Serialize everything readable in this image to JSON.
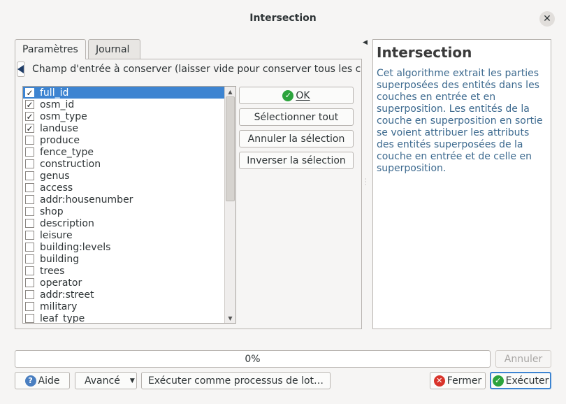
{
  "window": {
    "title": "Intersection"
  },
  "tabs": [
    {
      "label": "Paramètres",
      "active": true
    },
    {
      "label": "Journal",
      "active": false
    }
  ],
  "parameters": {
    "field_label": "Champ d'entrée à conserver (laisser vide pour conserver tous les champs)",
    "fields": [
      {
        "name": "full_id",
        "checked": true,
        "selected": true
      },
      {
        "name": "osm_id",
        "checked": true,
        "selected": false
      },
      {
        "name": "osm_type",
        "checked": true,
        "selected": false
      },
      {
        "name": "landuse",
        "checked": true,
        "selected": false
      },
      {
        "name": "produce",
        "checked": false,
        "selected": false
      },
      {
        "name": "fence_type",
        "checked": false,
        "selected": false
      },
      {
        "name": "construction",
        "checked": false,
        "selected": false
      },
      {
        "name": "genus",
        "checked": false,
        "selected": false
      },
      {
        "name": "access",
        "checked": false,
        "selected": false
      },
      {
        "name": "addr:housenumber",
        "checked": false,
        "selected": false
      },
      {
        "name": "shop",
        "checked": false,
        "selected": false
      },
      {
        "name": "description",
        "checked": false,
        "selected": false
      },
      {
        "name": "leisure",
        "checked": false,
        "selected": false
      },
      {
        "name": "building:levels",
        "checked": false,
        "selected": false
      },
      {
        "name": "building",
        "checked": false,
        "selected": false
      },
      {
        "name": "trees",
        "checked": false,
        "selected": false
      },
      {
        "name": "operator",
        "checked": false,
        "selected": false
      },
      {
        "name": "addr:street",
        "checked": false,
        "selected": false
      },
      {
        "name": "military",
        "checked": false,
        "selected": false
      },
      {
        "name": "leaf_type",
        "checked": false,
        "selected": false
      }
    ],
    "buttons": {
      "ok": "OK",
      "select_all": "Sélectionner tout",
      "clear_selection": "Annuler la sélection",
      "invert_selection": "Inverser la sélection"
    }
  },
  "help": {
    "title": "Intersection",
    "text": "Cet algorithme extrait les parties superposées des entités dans les couches en entrée et en superposition. Les entités de la couche en superposition en sortie se voient attribuer les attributs des entités superposées de la couche en entrée et de celle en superposition."
  },
  "progress": {
    "value": 0,
    "label": "0%"
  },
  "footer": {
    "cancel_run": "Annuler",
    "help": "Aide",
    "advanced": "Avancé",
    "batch": "Exécuter comme processus de lot…",
    "close": "Fermer",
    "run": "Exécuter"
  },
  "colors": {
    "accent": "#3d84d1",
    "ok_green": "#2ca33c",
    "help_text": "#3d6a8f"
  }
}
